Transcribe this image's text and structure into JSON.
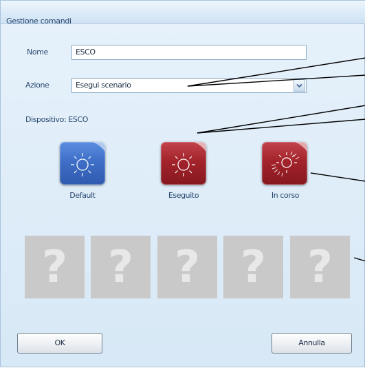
{
  "window": {
    "title": "Gestione comandi"
  },
  "form": {
    "name_label": "Nome",
    "name_value": "ESCO",
    "action_label": "Azione",
    "action_value": "Esegui scenario",
    "device_label": "Dispositivo: ESCO"
  },
  "states": [
    {
      "label": "Default",
      "color": "#3f6fc7",
      "icon": "sun-icon"
    },
    {
      "label": "Eseguito",
      "color": "#a3232b",
      "icon": "sun-icon"
    },
    {
      "label": "In corso",
      "color": "#a3232b",
      "icon": "sun-progress-icon"
    }
  ],
  "placeholders": [
    "?",
    "?",
    "?",
    "?",
    "?"
  ],
  "buttons": {
    "ok": "OK",
    "cancel": "Annulla"
  },
  "colors": {
    "accent_blue": "#3f6fc7",
    "accent_red": "#a3232b",
    "placeholder_gray": "#c9c9c9"
  }
}
